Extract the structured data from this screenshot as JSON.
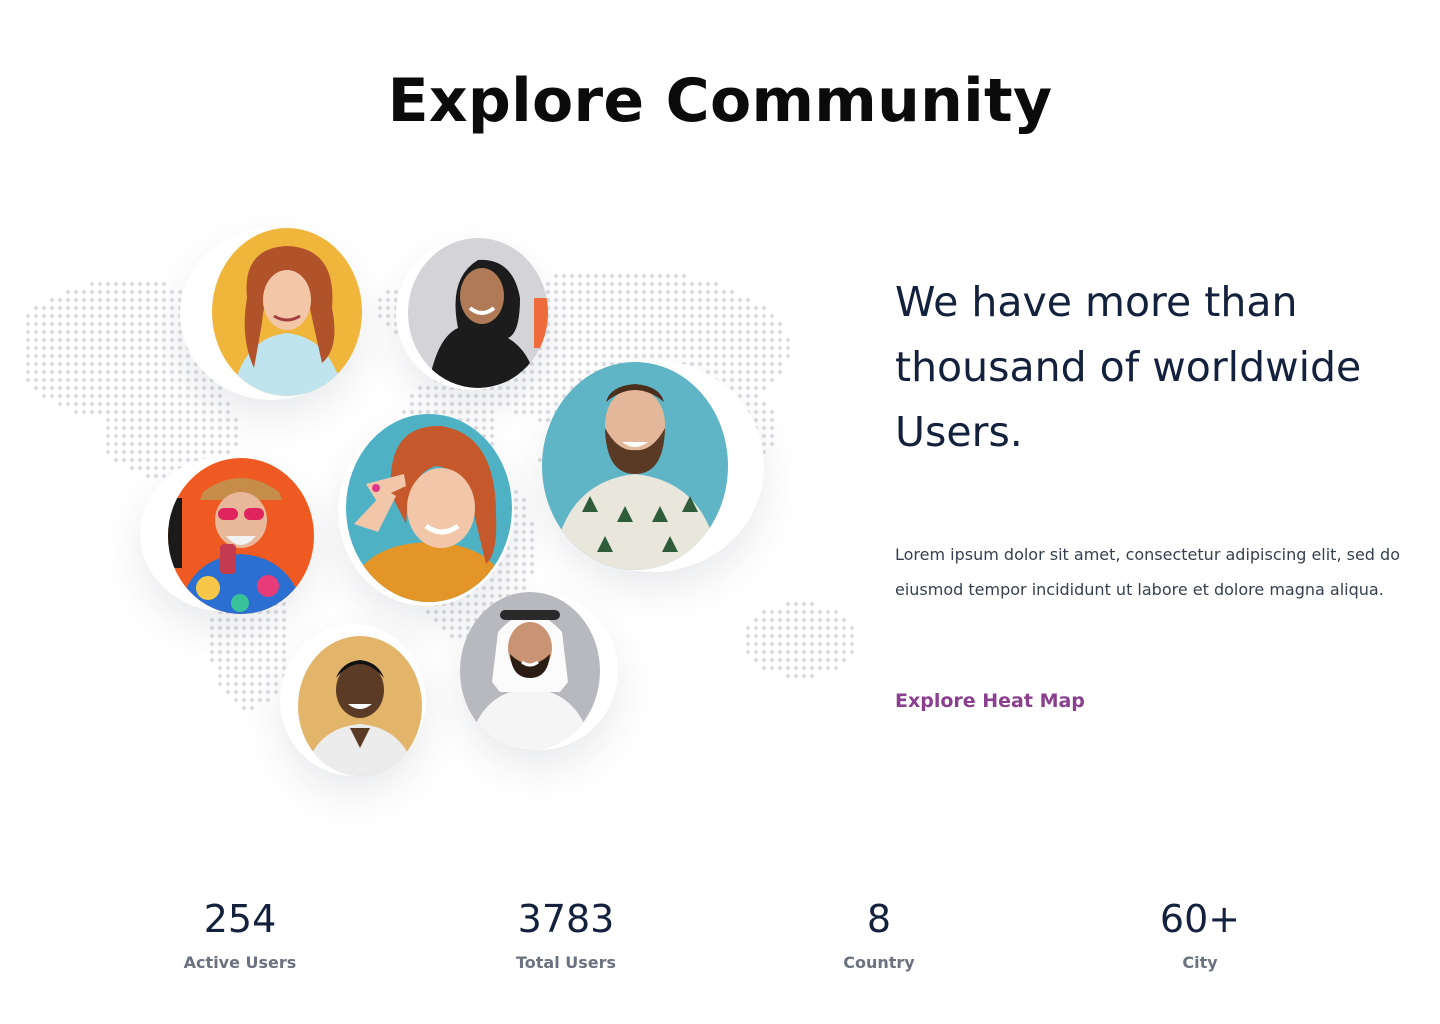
{
  "section": {
    "title": "Explore Community",
    "headline": "We have more than thousand of worldwide Users.",
    "description": "Lorem ipsum dolor sit amet, consectetur adipiscing elit, sed do eiusmod tempor incididunt ut labore et dolore magna aliqua.",
    "cta_label": "Explore Heat Map"
  },
  "colors": {
    "accent": "#8a3f8f",
    "heading": "#14213d",
    "muted": "#6b7280",
    "map_dot": "#d9dce1"
  },
  "stats": [
    {
      "value": "254",
      "label": "Active Users"
    },
    {
      "value": "3783",
      "label": "Total Users"
    },
    {
      "value": "8",
      "label": "Country"
    },
    {
      "value": "60+",
      "label": "City"
    }
  ]
}
